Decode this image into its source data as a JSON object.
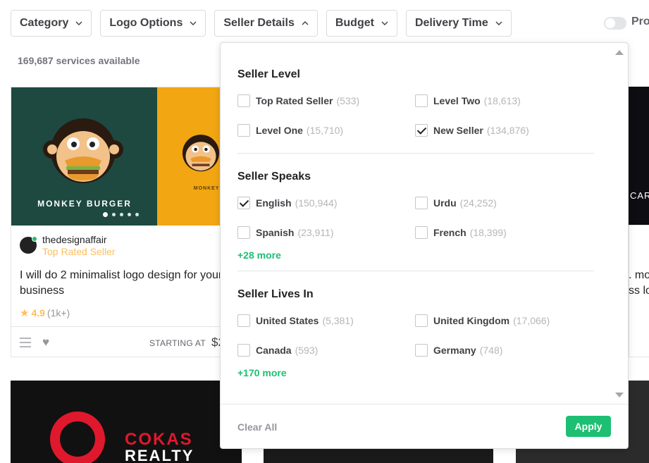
{
  "filters": [
    {
      "label": "Category",
      "icon": "chevron-down-icon"
    },
    {
      "label": "Logo Options",
      "icon": "chevron-down-icon"
    },
    {
      "label": "Seller Details",
      "icon": "chevron-up-icon"
    },
    {
      "label": "Budget",
      "icon": "chevron-down-icon"
    },
    {
      "label": "Delivery Time",
      "icon": "chevron-down-icon"
    }
  ],
  "pro_toggle": {
    "label": "Pro"
  },
  "results": {
    "count": "169,687",
    "suffix": "services available"
  },
  "gig": {
    "thumb_title": "MONKEY BURGER",
    "thumb_title_small": "MONKEY BURG",
    "seller_name": "thedesignaffair",
    "seller_badge": "Top Rated Seller",
    "title": "I will do 2 minimalist logo design for your business",
    "rating": "4.9",
    "rating_count": "(1k+)",
    "starting_label": "STARTING AT",
    "price": "$2"
  },
  "gig2": {
    "line1": "COKAS",
    "line2": "REALTY"
  },
  "gig_right": {
    "thumb_text": "CAR",
    "title_fragment": ". mo",
    "title_fragment2": "ss lo"
  },
  "seller_details": {
    "seller_level": {
      "title": "Seller Level",
      "options": [
        {
          "label": "Top Rated Seller",
          "count": "(533)",
          "checked": false
        },
        {
          "label": "Level Two",
          "count": "(18,613)",
          "checked": false
        },
        {
          "label": "Level One",
          "count": "(15,710)",
          "checked": false
        },
        {
          "label": "New Seller",
          "count": "(134,876)",
          "checked": true
        }
      ]
    },
    "seller_speaks": {
      "title": "Seller Speaks",
      "options": [
        {
          "label": "English",
          "count": "(150,944)",
          "checked": true
        },
        {
          "label": "Urdu",
          "count": "(24,252)",
          "checked": false
        },
        {
          "label": "Spanish",
          "count": "(23,911)",
          "checked": false
        },
        {
          "label": "French",
          "count": "(18,399)",
          "checked": false
        }
      ],
      "more": "+28 more"
    },
    "seller_lives_in": {
      "title": "Seller Lives In",
      "options": [
        {
          "label": "United States",
          "count": "(5,381)",
          "checked": false
        },
        {
          "label": "United Kingdom",
          "count": "(17,066)",
          "checked": false
        },
        {
          "label": "Canada",
          "count": "(593)",
          "checked": false
        },
        {
          "label": "Germany",
          "count": "(748)",
          "checked": false
        }
      ],
      "more": "+170 more"
    },
    "clear_all": "Clear All",
    "apply": "Apply"
  },
  "colors": {
    "accent": "#1dbf73",
    "rating": "#ffbe5b",
    "text": "#404145"
  }
}
